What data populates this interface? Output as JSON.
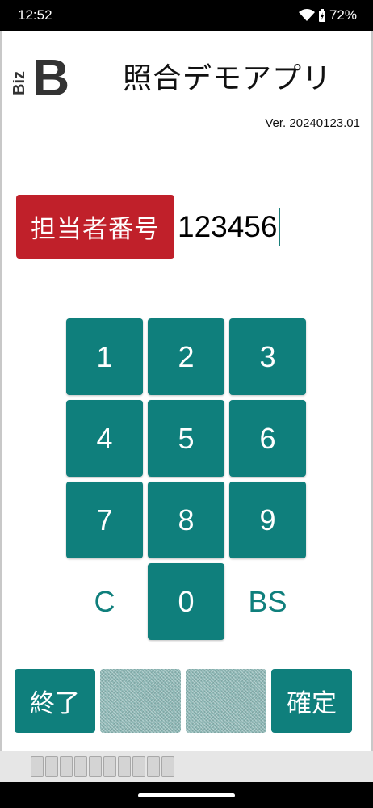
{
  "status": {
    "time": "12:52",
    "battery": "72%"
  },
  "app": {
    "title": "照合デモアプリ",
    "version": "Ver. 20240123.01",
    "logo": {
      "letters": "Biz",
      "big_letter": "B"
    }
  },
  "form": {
    "label": "担当者番号",
    "value": "123456"
  },
  "keypad": {
    "k1": "1",
    "k2": "2",
    "k3": "3",
    "k4": "4",
    "k5": "5",
    "k6": "6",
    "k7": "7",
    "k8": "8",
    "k9": "9",
    "clear": "C",
    "k0": "0",
    "backspace": "BS"
  },
  "buttons": {
    "exit": "終了",
    "confirm": "確定"
  },
  "colors": {
    "accent": "#0f7f7c",
    "label_bg": "#c0202a"
  }
}
